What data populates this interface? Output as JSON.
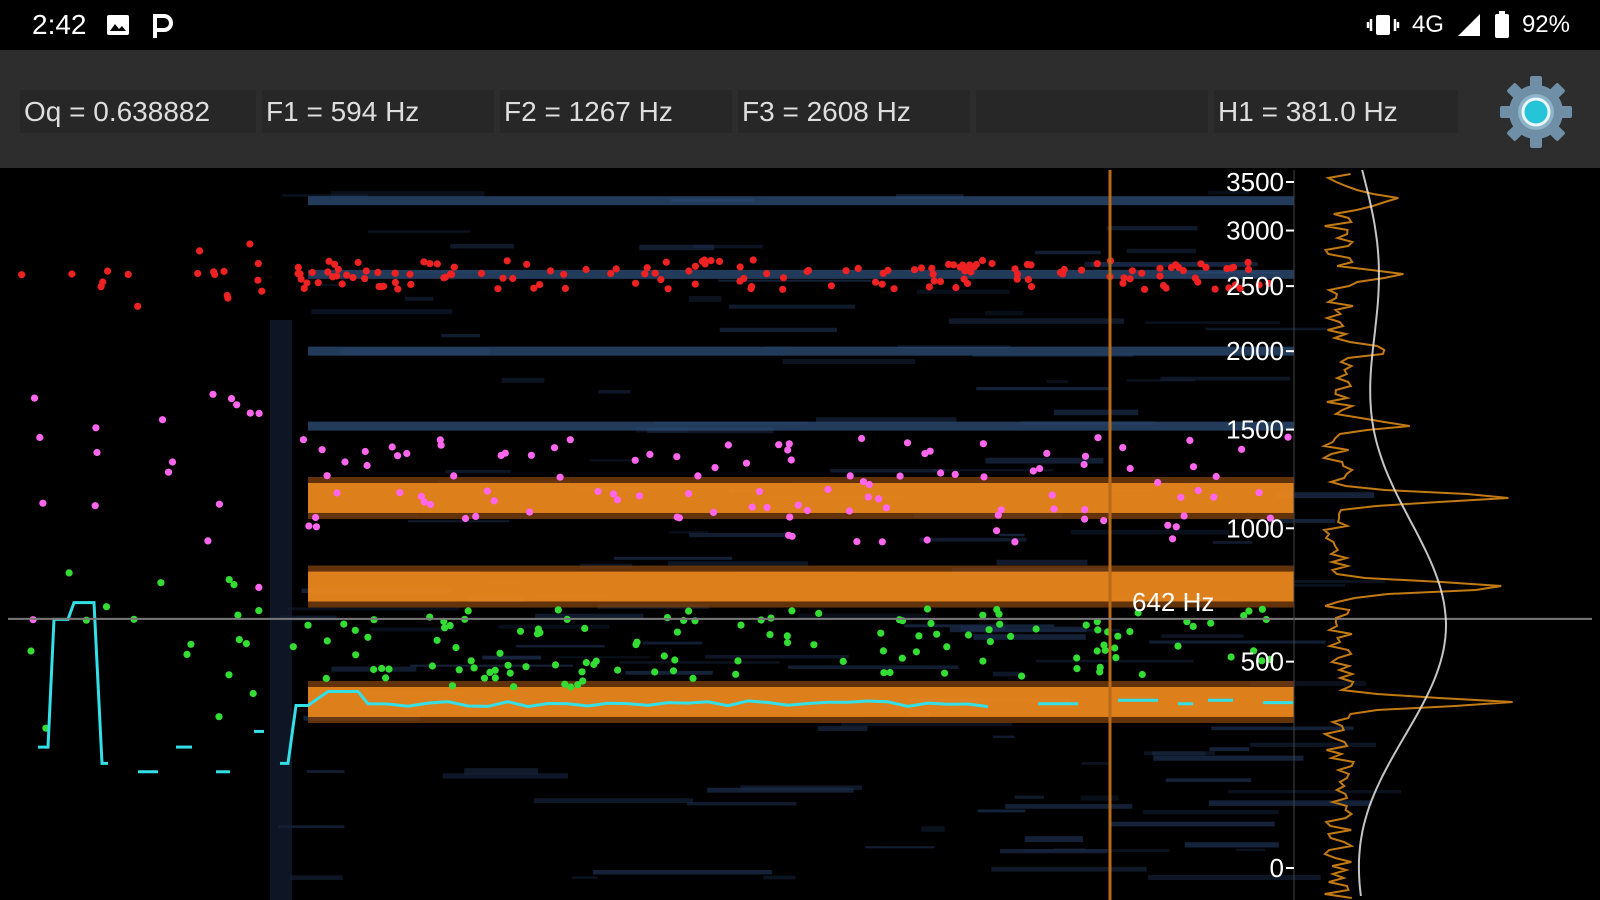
{
  "status_bar": {
    "time": "2:42",
    "left_icons": [
      "image-icon",
      "p-notification-icon"
    ],
    "right_icons": [
      "vibrate-icon",
      "signal-icon",
      "battery-icon"
    ],
    "network": "4G",
    "battery": "92%"
  },
  "readouts": {
    "oq": "Oq = 0.638882",
    "f1": "F1 = 594 Hz",
    "f2": "F2 = 1267 Hz",
    "f3": "F3 = 2608 Hz",
    "empty": "",
    "h1": "H1 = 381.0 Hz",
    "settings_icon": "gear-icon"
  },
  "colors": {
    "background": "#000000",
    "readout_bar": "#2d2d2d",
    "spectrum_orange": "#f08a1c",
    "f1_dots": "#33dd33",
    "f2_dots": "#ff66ee",
    "f3_dots": "#ee2222",
    "pitch_line": "#33e0e8"
  },
  "chart_data": {
    "type": "heatmap",
    "y_scale": "mel-like (non-linear)",
    "ylim": [
      0,
      3500
    ],
    "y_ticks": [
      "3500",
      "3000",
      "2500",
      "2000",
      "1500",
      "1000",
      "500",
      "0"
    ],
    "cursor_label": "642 Hz",
    "cursor_freq": 642,
    "series": [
      {
        "color": "#ee2222",
        "approx_hz": 2600
      },
      {
        "color": "#ff66ee",
        "approx_hz": 1200
      },
      {
        "color": "#33dd33",
        "approx_hz": 550
      },
      {
        "color": "#33e0e8",
        "approx_hz": 380
      }
    ],
    "harmonic_bands_hz": [
      380,
      760,
      1140,
      1520,
      2000,
      2600,
      3300
    ]
  }
}
